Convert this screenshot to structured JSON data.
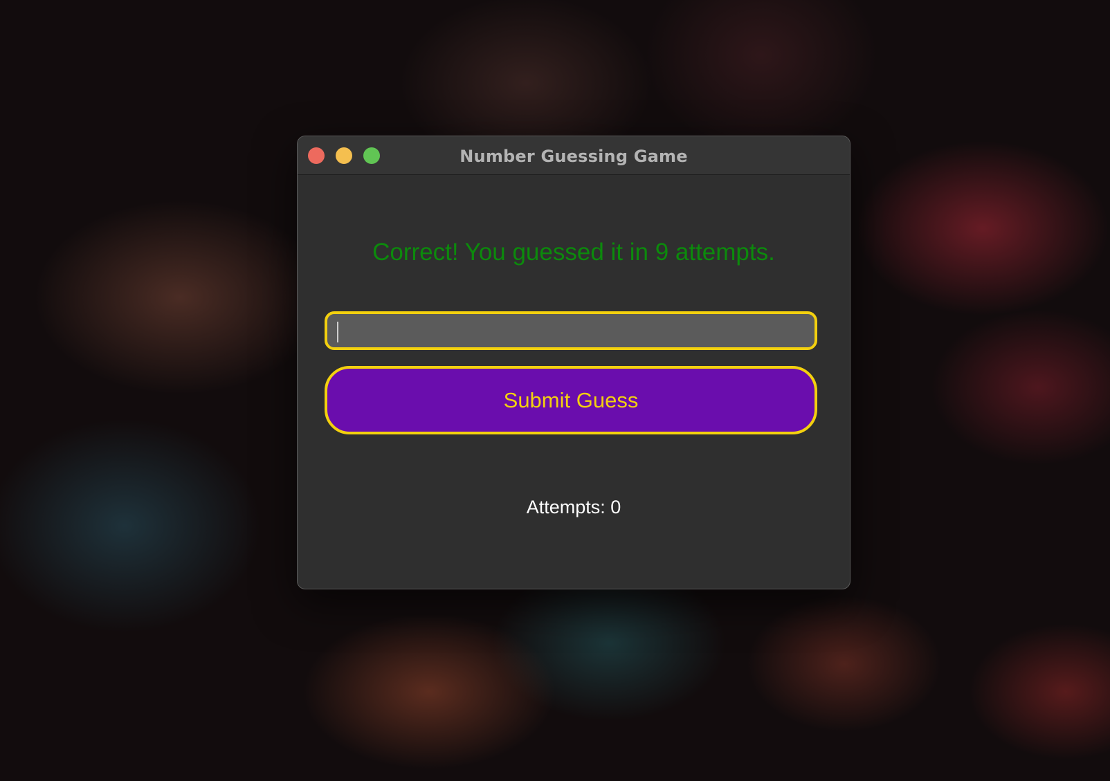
{
  "window": {
    "title": "Number Guessing Game"
  },
  "game": {
    "status_message": "Correct! You guessed it in 9 attempts.",
    "guess_input_value": "",
    "guess_input_placeholder": "",
    "submit_label": "Submit Guess",
    "attempts_label": "Attempts: 0"
  },
  "colors": {
    "status_text": "#0c8a0c",
    "accent_border": "#f3d00f",
    "button_fill": "#6a0dad",
    "window_bg": "#2f2f2f"
  },
  "icons": {
    "close": "close-icon",
    "minimize": "minimize-icon",
    "zoom": "zoom-icon"
  }
}
